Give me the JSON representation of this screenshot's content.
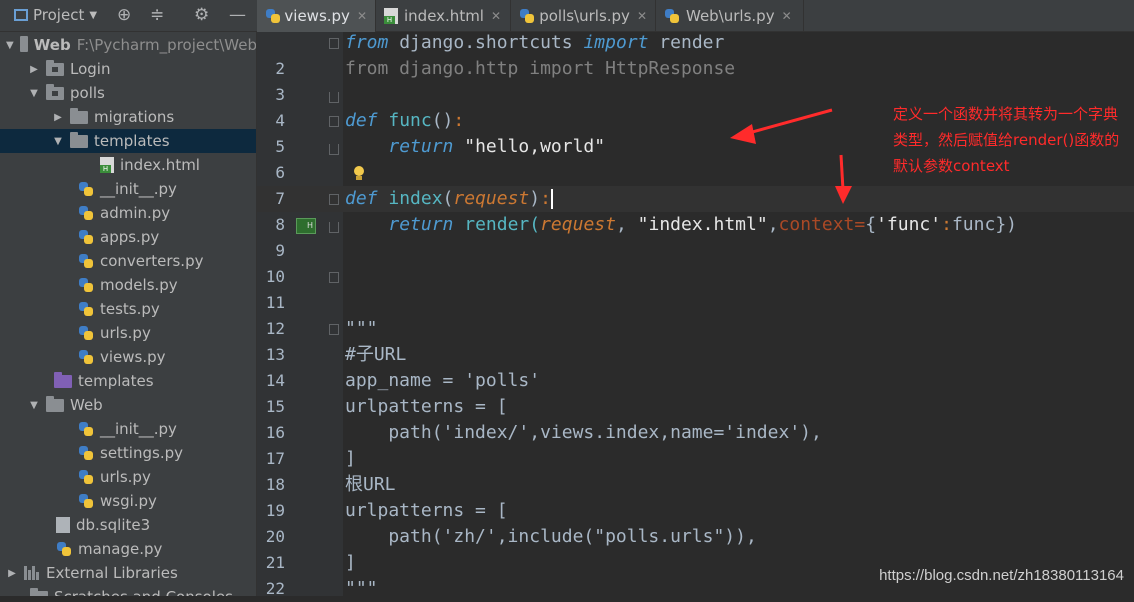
{
  "sidebar": {
    "title": "Project",
    "items": [
      {
        "label": "Web",
        "path": "F:\\Pycharm_project\\Web",
        "icon": "folder-icon"
      },
      {
        "label": "Login",
        "icon": "folder-icon"
      },
      {
        "label": "polls",
        "icon": "folder-icon"
      },
      {
        "label": "migrations",
        "icon": "folder-icon"
      },
      {
        "label": "templates",
        "icon": "folder-icon"
      },
      {
        "label": "index.html",
        "icon": "html-file-icon"
      },
      {
        "label": "__init__.py",
        "icon": "python-file-icon"
      },
      {
        "label": "admin.py",
        "icon": "python-file-icon"
      },
      {
        "label": "apps.py",
        "icon": "python-file-icon"
      },
      {
        "label": "converters.py",
        "icon": "python-file-icon"
      },
      {
        "label": "models.py",
        "icon": "python-file-icon"
      },
      {
        "label": "tests.py",
        "icon": "python-file-icon"
      },
      {
        "label": "urls.py",
        "icon": "python-file-icon"
      },
      {
        "label": "views.py",
        "icon": "python-file-icon"
      },
      {
        "label": "templates",
        "icon": "templates-folder-icon"
      },
      {
        "label": "Web",
        "icon": "folder-icon"
      },
      {
        "label": "__init__.py",
        "icon": "python-file-icon"
      },
      {
        "label": "settings.py",
        "icon": "python-file-icon"
      },
      {
        "label": "urls.py",
        "icon": "python-file-icon"
      },
      {
        "label": "wsgi.py",
        "icon": "python-file-icon"
      },
      {
        "label": "db.sqlite3",
        "icon": "database-file-icon"
      },
      {
        "label": "manage.py",
        "icon": "python-file-icon"
      },
      {
        "label": "External Libraries",
        "icon": "library-icon"
      },
      {
        "label": "Scratches and Consoles",
        "icon": "scratch-icon"
      }
    ]
  },
  "tabs": [
    {
      "label": "views.py",
      "active": true
    },
    {
      "label": "index.html",
      "active": false
    },
    {
      "label": "polls\\urls.py",
      "active": false
    },
    {
      "label": "Web\\urls.py",
      "active": false
    }
  ],
  "editor": {
    "line_numbers": [
      "2",
      "3",
      "4",
      "5",
      "6",
      "7",
      "8",
      "9",
      "10",
      "11",
      "12",
      "13",
      "14",
      "15",
      "16",
      "17",
      "18",
      "19",
      "20",
      "21",
      "22"
    ],
    "code": {
      "l1_from": "from",
      "l1_mod": " django.shortcuts ",
      "l1_import": "import",
      "l1_name": " render",
      "l2": "from django.http import HttpResponse",
      "l4_def": "def",
      "l4_name": " func",
      "l4_parens": "()",
      "l4_colon": ":",
      "l5_indent": "    ",
      "l5_return": "return",
      "l5_str": " \"hello,world\"",
      "l7_def": "def",
      "l7_name": " index",
      "l7_open": "(",
      "l7_param": "request",
      "l7_close": ")",
      "l7_colon": ":",
      "l8_indent": "    ",
      "l8_return": "return",
      "l8_call": " render(",
      "l8_param": "request",
      "l8_sep": ", ",
      "l8_str": "\"index.html\"",
      "l8_comma": ",",
      "l8_kw": "context",
      "l8_eq": "=",
      "l8_brace1": "{",
      "l8_key": "'func'",
      "l8_colon": ":",
      "l8_val": "func",
      "l8_end": "})",
      "l12": "\"\"\"",
      "l13": "#子URL",
      "l14": "app_name = 'polls'",
      "l15": "urlpatterns = [",
      "l16": "    path('index/',views.index,name='index'),",
      "l17": "]",
      "l18": "根URL",
      "l19": "urlpatterns = [",
      "l20": "    path('zh/',include(\"polls.urls\")),",
      "l21": "]",
      "l22": "\"\"\""
    }
  },
  "annotation": {
    "text": "定义一个函数并将其转为一个字典类型，然后赋值给render()函数的默认参数context",
    "color": "#ff2b2b"
  },
  "watermark": "https://blog.csdn.net/zh18380113164",
  "colors": {
    "keyword": "#cc7832",
    "function": "#ffc66d",
    "string": "#6a8759",
    "parameter": "#94558d",
    "background": "#2b2b2b"
  }
}
